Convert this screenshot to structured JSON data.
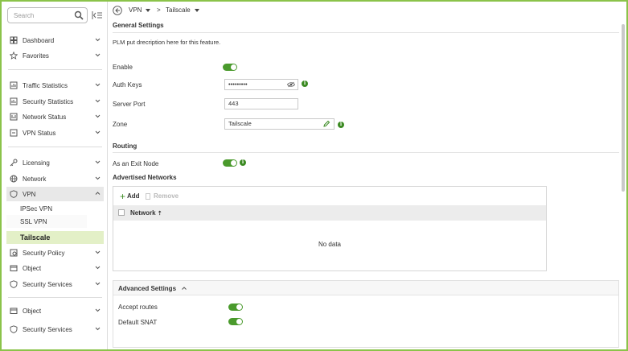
{
  "sidebar": {
    "search_placeholder": "Search",
    "groups": [
      {
        "label": "Dashboard",
        "icon": "dashboard-icon"
      },
      {
        "label": "Favorites",
        "icon": "star-icon"
      },
      {
        "label": "Traffic Statistics",
        "icon": "chart-icon"
      },
      {
        "label": "Security Statistics",
        "icon": "chart-icon"
      },
      {
        "label": "Network Status",
        "icon": "chart-icon"
      },
      {
        "label": "VPN Status",
        "icon": "monitor-icon"
      },
      {
        "label": "Licensing",
        "icon": "key-icon"
      },
      {
        "label": "Network",
        "icon": "globe-icon"
      },
      {
        "label": "VPN",
        "icon": "shield-icon"
      },
      {
        "label": "Security Policy",
        "icon": "policy-icon"
      },
      {
        "label": "Object",
        "icon": "object-icon"
      },
      {
        "label": "Security Services",
        "icon": "shield-icon"
      },
      {
        "label": "Object",
        "icon": "object-icon"
      },
      {
        "label": "Security Services",
        "icon": "shield-icon"
      }
    ],
    "vpn_sub": [
      "IPSec VPN",
      "SSL VPN",
      "Tailscale"
    ]
  },
  "breadcrumb": {
    "first": "VPN",
    "sep": ">",
    "second": "Tailscale"
  },
  "general": {
    "title": "General Settings",
    "description": "PLM put drecription here for this feature.",
    "enable_label": "Enable",
    "auth_keys_label": "Auth Keys",
    "auth_keys_value": "•••••••••",
    "server_port_label": "Server Port",
    "server_port_value": "443",
    "zone_label": "Zone",
    "zone_value": "Tailscale"
  },
  "routing": {
    "title": "Routing",
    "exit_node_label": "As an Exit Node",
    "advertised_title": "Advertised Networks",
    "add_label": "Add",
    "remove_label": "Remove",
    "col_network": "Network",
    "empty_text": "No data"
  },
  "advanced": {
    "title": "Advanced Settings",
    "accept_routes_label": "Accept routes",
    "default_snat_label": "Default SNAT"
  },
  "colors": {
    "accent": "#4a9a2c",
    "active_nav": "#e3f0c7",
    "frame": "#8bc34a"
  }
}
